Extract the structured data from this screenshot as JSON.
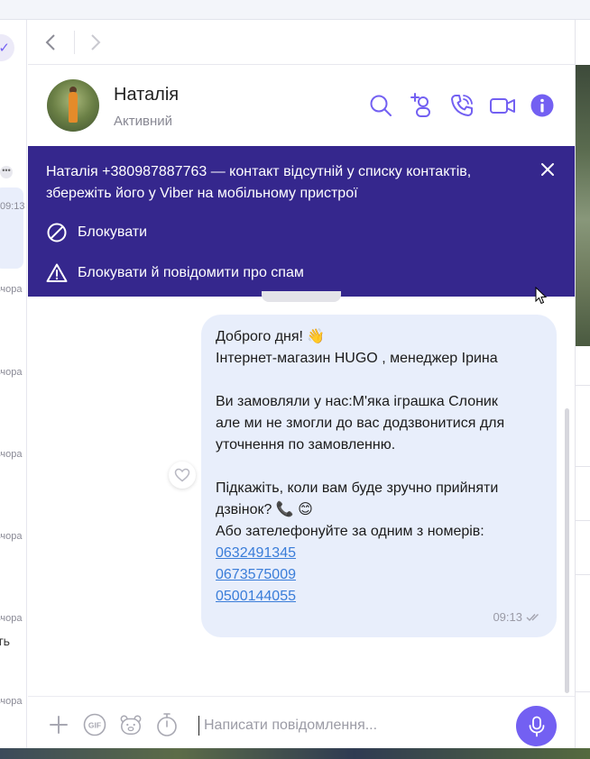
{
  "sidebar": {
    "dots": "•••",
    "items": [
      {
        "time": "09:13"
      },
      {
        "text": "вчора"
      },
      {
        "text": "вчора"
      },
      {
        "text": "вчора"
      },
      {
        "text": "вчора"
      },
      {
        "text": "вчора"
      },
      {
        "text": "вчора"
      }
    ],
    "snippet": "ТЬ"
  },
  "contact": {
    "name": "Наталія",
    "status": "Активний"
  },
  "header_icons": [
    "search-icon",
    "add-contact-icon",
    "audio-call-icon",
    "video-call-icon",
    "info-icon"
  ],
  "banner": {
    "text": "Наталія +380987887763 — контакт відсутній у списку контактів, збережіть його у Viber на мобільному пристрої",
    "block_label": "Блокувати",
    "block_report_label": "Блокувати й повідомити про спам"
  },
  "message": {
    "lines": [
      "Доброго дня! 👋",
      "Інтернет-магазин HUGO , менеджер Ірина",
      "",
      "Ви замовляли у нас:М'яка іграшка Слоник",
      "але ми не змогли до вас додзвонитися для",
      "уточнення по замовленню.",
      "",
      "Підкажіть, коли вам буде зручно прийняти",
      "дзвінок? 📞 😊",
      "Або зателефонуйте за одним з номерів:"
    ],
    "phones": [
      "0632491345",
      "0673575009",
      "0500144055"
    ],
    "time": "09:13"
  },
  "composer": {
    "placeholder": "Написати повідомлення..."
  },
  "colors": {
    "accent": "#7360f2",
    "banner": "#35278d",
    "bubble": "#e8eefb",
    "link": "#3a7dd9"
  }
}
